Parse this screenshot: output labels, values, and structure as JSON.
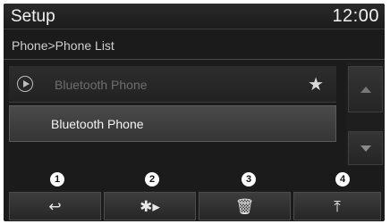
{
  "header": {
    "title": "Setup",
    "clock": "12:00"
  },
  "breadcrumb": "Phone>Phone List",
  "list": [
    {
      "label": "Bluetooth Phone",
      "icon": "play-icon",
      "favorite_icon": "star-icon",
      "state": "connected-dimmed"
    },
    {
      "label": "Bluetooth Phone",
      "state": "selected"
    }
  ],
  "scroll": {
    "up_icon": "arrow-up-icon",
    "down_icon": "arrow-down-icon"
  },
  "callouts": [
    "1",
    "2",
    "3",
    "4"
  ],
  "toolbar": {
    "buttons": [
      {
        "icon": "back-icon",
        "glyph": "↩"
      },
      {
        "icon": "bluetooth-connect-icon",
        "glyph": "✱▸"
      },
      {
        "icon": "trash-icon",
        "glyph": "🗑"
      },
      {
        "icon": "move-to-top-icon",
        "glyph": "⤒"
      }
    ]
  },
  "colors": {
    "background": "#1b1b1b",
    "text": "#f2f2f2",
    "selected_row": "#404040"
  }
}
